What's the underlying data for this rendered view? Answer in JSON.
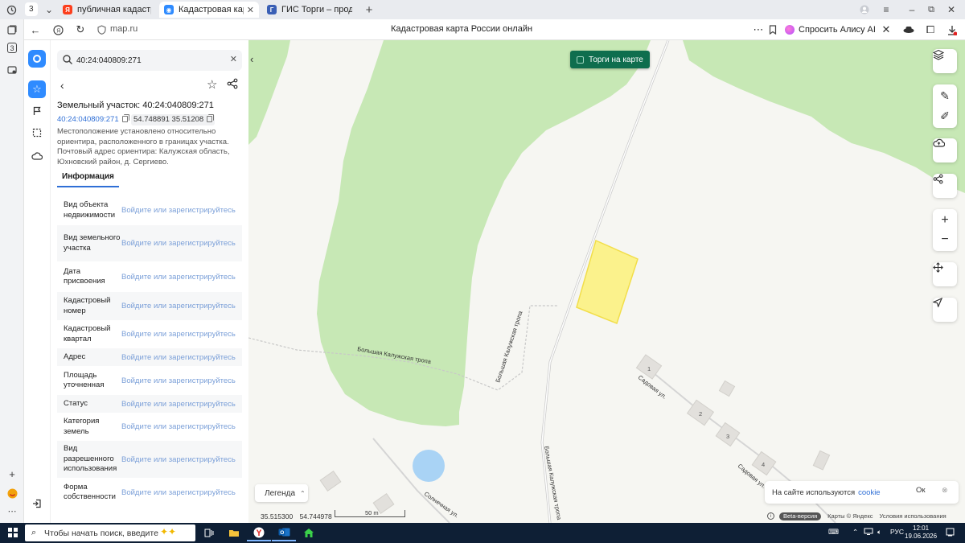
{
  "browser": {
    "tab_count": "3",
    "tabs": [
      {
        "label": "публичная кадастровая к",
        "favicon": "yandex"
      },
      {
        "label": "Кадастровая карта Рос",
        "favicon": "map"
      },
      {
        "label": "ГИС Торги – продажи гос",
        "favicon": "gis"
      }
    ],
    "url": "map.ru",
    "page_title": "Кадастровая карта России онлайн",
    "alice_label": "Спросить Алису AI"
  },
  "search": {
    "value": "40:24:040809:271"
  },
  "parcel": {
    "title": "Земельный участок: 40:24:040809:271",
    "cadastral_number": "40:24:040809:271",
    "coords": "54.748891 35.51208",
    "location_text": "Местоположение установлено относительно ориентира, расположенного в границах участка. Почтовый адрес ориентира: Калужская область, Юхновский район, д. Сергиево.",
    "tab": "Информация",
    "rows": [
      {
        "key": "Вид объекта недвижимости",
        "value": "Войдите или зарегистрируйтесь"
      },
      {
        "key": "Вид земельного участка",
        "value": "Войдите или зарегистрируйтесь"
      },
      {
        "key": "Дата присвоения",
        "value": "Войдите или зарегистрируйтесь"
      },
      {
        "key": "Кадастровый номер",
        "value": "Войдите или зарегистрируйтесь"
      },
      {
        "key": "Кадастровый квартал",
        "value": "Войдите или зарегистрируйтесь"
      },
      {
        "key": "Адрес",
        "value": "Войдите или зарегистрируйтесь"
      },
      {
        "key": "Площадь уточненная",
        "value": "Войдите или зарегистрируйтесь"
      },
      {
        "key": "Статус",
        "value": "Войдите или зарегистрируйтесь"
      },
      {
        "key": "Категория земель",
        "value": "Войдите или зарегистрируйтесь"
      },
      {
        "key": "Вид разрешенного использования",
        "value": "Войдите или зарегистрируйтесь"
      },
      {
        "key": "Форма собственности",
        "value": "Войдите или зарегистрируйтесь"
      }
    ]
  },
  "map": {
    "torgi_label": "Торги на карте",
    "roads": [
      "Большая Калужская тропа",
      "Большая Калужская тропа",
      "Большая Калужская тропа",
      "Садовая ул.",
      "Садовая ул.",
      "Солнечная ул."
    ],
    "house_numbers": [
      "1",
      "2",
      "3",
      "4"
    ],
    "legend_label": "Легенда",
    "cursor_lon": "35.515300",
    "cursor_lat": "54.744978",
    "scale_label": "50 m",
    "cookie_text": "На сайте используются",
    "cookie_link": "cookie",
    "cookie_ok": "Ок",
    "beta_label": "Beta-версия",
    "attribution": "Карты © Яндекс",
    "terms": "Условия использования",
    "colors": {
      "forest": "#c7e8b5",
      "parcel_fill": "#fbf28c",
      "parcel_stroke": "#f2de4a",
      "water": "#a9d3f5",
      "buildings": "#e2e0dc"
    }
  },
  "taskbar": {
    "search_placeholder": "Чтобы начать поиск, введите",
    "language": "РУС",
    "time": "12:01",
    "date": "19.06.2026"
  }
}
